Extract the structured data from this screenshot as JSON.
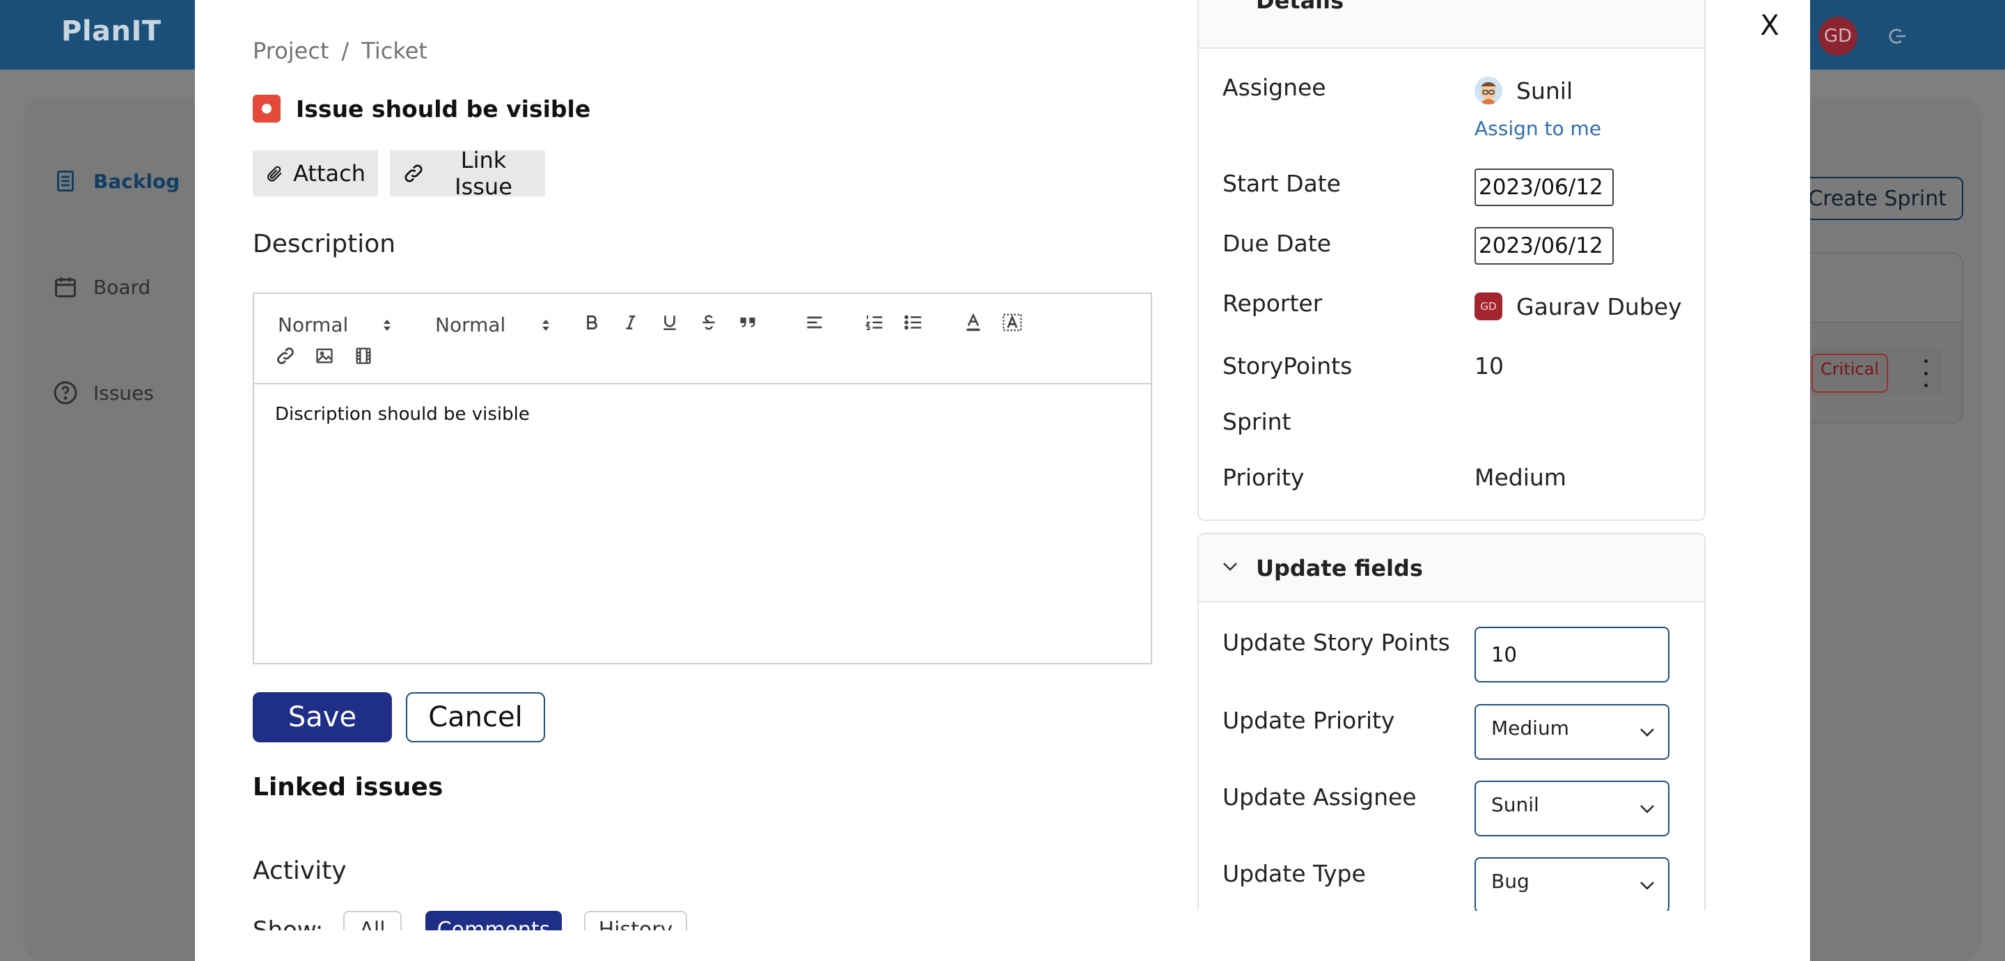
{
  "app": {
    "logo": "PlanIT",
    "user_initials": "GD",
    "nav": [
      {
        "label": "Backlog",
        "icon": "backlog-icon"
      },
      {
        "label": "Board",
        "icon": "calendar-icon"
      },
      {
        "label": "Issues",
        "icon": "help-circle-icon"
      }
    ],
    "create_sprint_label": "Create Sprint",
    "priority_badge": "Critical"
  },
  "modal": {
    "close_label": "X",
    "breadcrumb": {
      "project": "Project",
      "separator": "/",
      "ticket": "Ticket"
    },
    "issue_title": "Issue should be visible",
    "attach_label": "Attach",
    "link_issue_label": "Link Issue",
    "description_heading": "Description",
    "editor": {
      "header_select": "Normal",
      "size_select": "Normal",
      "content": "Discription should be visible"
    },
    "save_label": "Save",
    "cancel_label": "Cancel",
    "linked_issues_heading": "Linked issues",
    "activity_heading": "Activity",
    "show_label": "Show:",
    "show_filters": [
      "All",
      "Comments",
      "History"
    ]
  },
  "details": {
    "heading": "Details",
    "assignee_label": "Assignee",
    "assignee_value": "Sunil",
    "assign_to_me": "Assign to me",
    "start_date_label": "Start Date",
    "start_date_value": "2023/06/12",
    "due_date_label": "Due Date",
    "due_date_value": "2023/06/12",
    "reporter_label": "Reporter",
    "reporter_initials": "GD",
    "reporter_value": "Gaurav Dubey",
    "story_points_label": "StoryPoints",
    "story_points_value": "10",
    "sprint_label": "Sprint",
    "sprint_value": "",
    "priority_label": "Priority",
    "priority_value": "Medium"
  },
  "update_fields": {
    "heading": "Update fields",
    "story_points_label": "Update Story Points",
    "story_points_value": "10",
    "priority_label": "Update Priority",
    "priority_value": "Medium",
    "assignee_label": "Update Assignee",
    "assignee_value": "Sunil",
    "type_label": "Update Type",
    "type_value": "Bug"
  },
  "colors": {
    "topbar": "#1b4f78",
    "primary_button": "#1f2e86",
    "bug": "#e5493a",
    "link": "#2d6fb2",
    "avatar": "#a3252f"
  }
}
